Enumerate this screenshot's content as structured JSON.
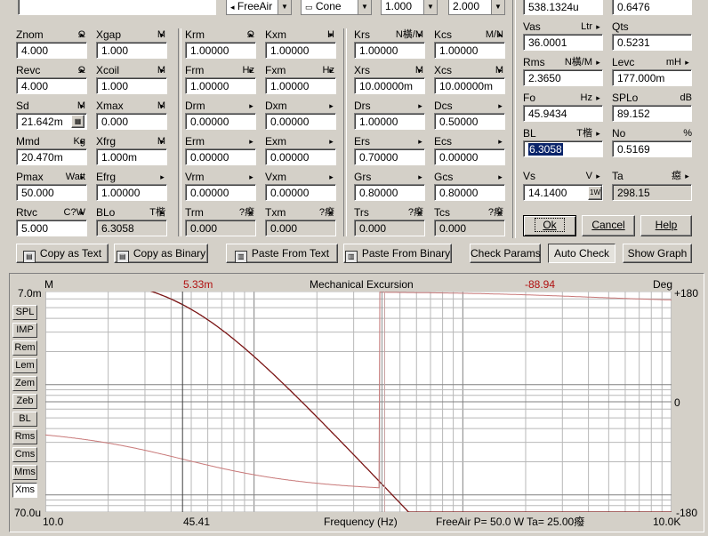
{
  "toolbar": {
    "mode": "FreeAir",
    "cone": "Cone",
    "val1": "1.000",
    "val2": "2.000"
  },
  "params": [
    {
      "id": "znom",
      "label": "Znom",
      "unit": "Ω",
      "value": "4.000"
    },
    {
      "id": "xgap",
      "label": "Xgap",
      "unit": "M",
      "value": "1.000"
    },
    {
      "id": "krm",
      "label": "Krm",
      "unit": "Ω",
      "value": "1.00000"
    },
    {
      "id": "kxm",
      "label": "Kxm",
      "unit": "H",
      "value": "1.00000"
    },
    {
      "id": "krs",
      "label": "Krs",
      "unit": "N橫/M",
      "value": "1.00000"
    },
    {
      "id": "kcs",
      "label": "Kcs",
      "unit": "M/N",
      "value": "1.00000"
    },
    {
      "id": "revc",
      "label": "Revc",
      "unit": "Ω",
      "value": "4.000"
    },
    {
      "id": "xcoil",
      "label": "Xcoil",
      "unit": "M",
      "value": "1.000"
    },
    {
      "id": "frm",
      "label": "Frm",
      "unit": "Hz",
      "value": "1.00000"
    },
    {
      "id": "fxm",
      "label": "Fxm",
      "unit": "Hz",
      "value": "1.00000"
    },
    {
      "id": "xrs",
      "label": "Xrs",
      "unit": "M",
      "value": "10.00000m"
    },
    {
      "id": "xcs",
      "label": "Xcs",
      "unit": "M",
      "value": "10.00000m"
    },
    {
      "id": "sd",
      "label": "Sd",
      "unit": "M",
      "value": "21.642m"
    },
    {
      "id": "xmax",
      "label": "Xmax",
      "unit": "M",
      "value": "0.000"
    },
    {
      "id": "drm",
      "label": "Drm",
      "unit": "",
      "value": "0.00000"
    },
    {
      "id": "dxm",
      "label": "Dxm",
      "unit": "",
      "value": "0.00000"
    },
    {
      "id": "drs",
      "label": "Drs",
      "unit": "",
      "value": "1.00000"
    },
    {
      "id": "dcs",
      "label": "Dcs",
      "unit": "",
      "value": "0.50000"
    },
    {
      "id": "mmd",
      "label": "Mmd",
      "unit": "Kg",
      "value": "20.470m"
    },
    {
      "id": "xfrg",
      "label": "Xfrg",
      "unit": "M",
      "value": "1.000m"
    },
    {
      "id": "erm",
      "label": "Erm",
      "unit": "",
      "value": "0.00000"
    },
    {
      "id": "exm",
      "label": "Exm",
      "unit": "",
      "value": "0.00000"
    },
    {
      "id": "ers",
      "label": "Ers",
      "unit": "",
      "value": "0.70000"
    },
    {
      "id": "ecs",
      "label": "Ecs",
      "unit": "",
      "value": "0.00000"
    },
    {
      "id": "pmax",
      "label": "Pmax",
      "unit": "Watt",
      "value": "50.000"
    },
    {
      "id": "efrg",
      "label": "Efrg",
      "unit": "",
      "value": "1.00000"
    },
    {
      "id": "vrm",
      "label": "Vrm",
      "unit": "",
      "value": "0.00000"
    },
    {
      "id": "vxm",
      "label": "Vxm",
      "unit": "",
      "value": "0.00000"
    },
    {
      "id": "grs",
      "label": "Grs",
      "unit": "",
      "value": "0.80000"
    },
    {
      "id": "gcs",
      "label": "Gcs",
      "unit": "",
      "value": "0.80000"
    },
    {
      "id": "rtvc",
      "label": "Rtvc",
      "unit": "C?W",
      "value": "5.000"
    },
    {
      "id": "blo",
      "label": "BLo",
      "unit": "T楷",
      "value": "6.3058"
    },
    {
      "id": "trm",
      "label": "Trm",
      "unit": "?癈",
      "value": "0.000"
    },
    {
      "id": "txm",
      "label": "Txm",
      "unit": "?癈",
      "value": "0.000"
    },
    {
      "id": "trs",
      "label": "Trs",
      "unit": "?癈",
      "value": "0.000"
    },
    {
      "id": "tcs",
      "label": "Tcs",
      "unit": "?癈",
      "value": "0.000"
    }
  ],
  "right": {
    "top1": "538.1324u",
    "top2": "0.6476",
    "vas_label": "Vas",
    "vas_unit": "Ltr",
    "vas": "36.0001",
    "qts_label": "Qts",
    "qts": "0.5231",
    "rms_label": "Rms",
    "rms_unit": "N橫/M",
    "rms": "2.3650",
    "levc_label": "Levc",
    "levc_unit": "mH",
    "levc": "177.000m",
    "fo_label": "Fo",
    "fo_unit": "Hz",
    "fo": "45.9434",
    "splo_label": "SPLo",
    "splo_unit": "dB",
    "splo": "89.152",
    "bl_label": "BL",
    "bl_unit": "T楷",
    "bl": "6.3058",
    "no_label": "No",
    "no_unit": "%",
    "no": "0.5169",
    "vs_label": "Vs",
    "vs_unit": "V",
    "vs": "14.1400",
    "ta_label": "Ta",
    "ta_unit": "癋",
    "ta": "298.15",
    "w_label": "1W",
    "ok": "Ok",
    "cancel": "Cancel",
    "help": "Help"
  },
  "buttons": {
    "copy_text": "Copy as Text",
    "copy_binary": "Copy as Binary",
    "paste_text": "Paste From Text",
    "paste_binary": "Paste From Binary",
    "check_params": "Check Params",
    "auto_check": "Auto Check",
    "show_graph": "Show Graph"
  },
  "side_buttons": [
    "SPL",
    "IMP",
    "Rem",
    "Lem",
    "Zem",
    "Zeb",
    "BL",
    "Rms",
    "Cms",
    "Mms",
    "Xms"
  ],
  "graph": {
    "title": "Mechanical Excursion",
    "left_unit": "M",
    "right_unit": "Deg",
    "cursor_mag": "5.33m",
    "cursor_phase": "-88.94",
    "y_top": "7.0m",
    "y_bottom": "70.0u",
    "r_top": "+180",
    "r_mid": "0",
    "r_bottom": "-180",
    "x_start": "10.0",
    "x_cursor": "45.41",
    "x_label": "Frequency (Hz)",
    "x_end": "10.0K",
    "status": "FreeAir  P=  50.0 W  Ta=  25.00癈"
  },
  "colors": {
    "curve_mag": "#7a1414",
    "curve_phase": "#c87878",
    "grid": "#b8b8b8",
    "accent_text": "#b01010"
  }
}
